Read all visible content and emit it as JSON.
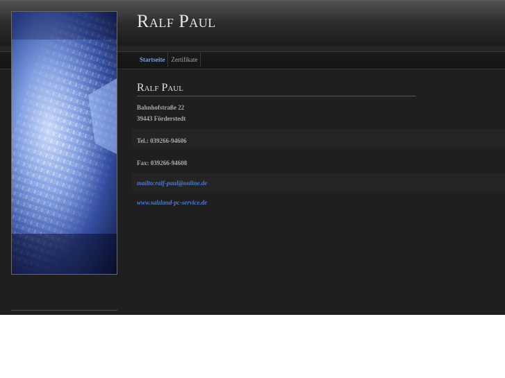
{
  "site": {
    "title": "Ralf Paul"
  },
  "nav": {
    "items": [
      {
        "label": "Startseite"
      },
      {
        "label": "Zertifikate"
      }
    ]
  },
  "content": {
    "heading": "Ralf Paul",
    "street": "Bahnhofstraße 22",
    "city": "39443 Förderstedt",
    "phone": "Tel.: 039266-94606",
    "fax": "Fax: 039266-94608",
    "email_link": "mailto:ralf-paul@online.de",
    "web_link": "www.salzland-pc-service.de"
  },
  "colors": {
    "accent": "#7aa0e0",
    "link": "#4f79c9",
    "background": "#1f1f1f",
    "text": "#a9a9a9"
  },
  "sidebar": {
    "image": "binary-code-blue-photo"
  }
}
